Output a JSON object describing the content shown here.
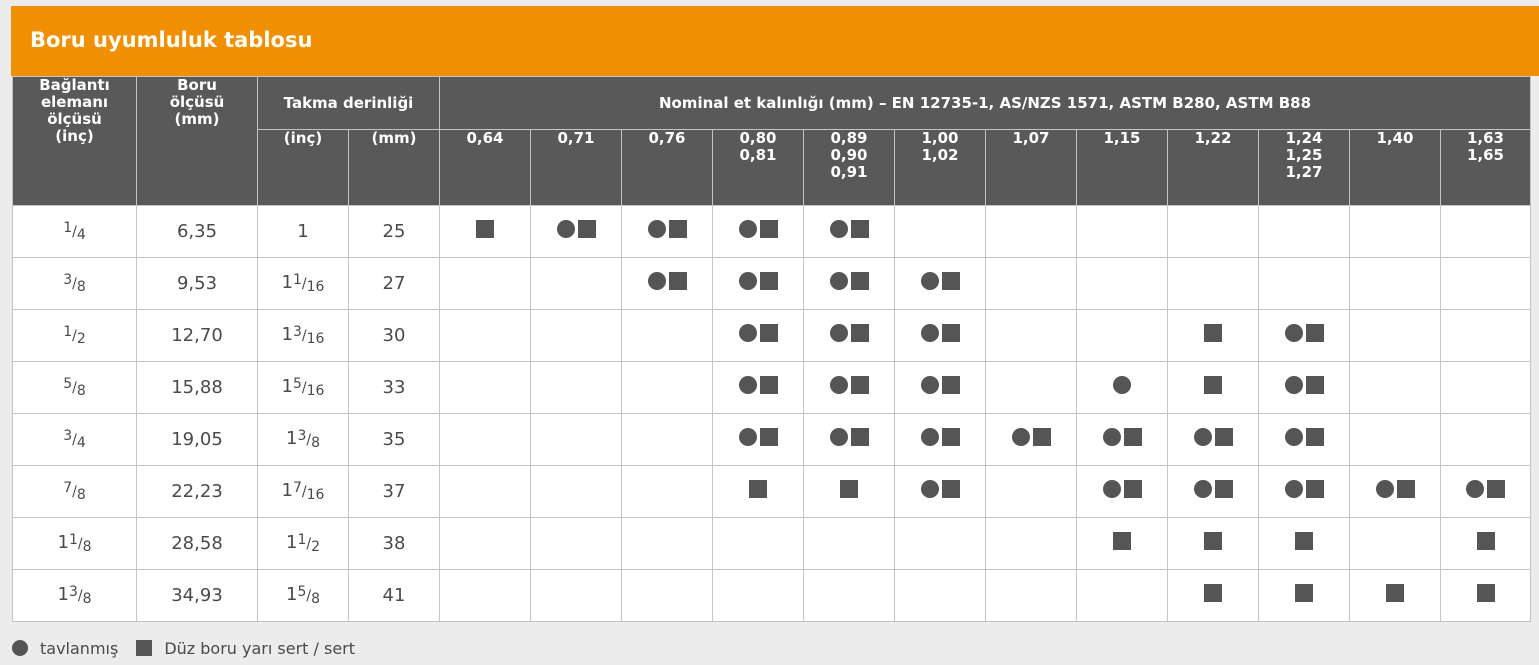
{
  "title": "Boru uyumluluk tablosu",
  "headers": {
    "connector": "Bağlantı elemanı ölçüsü (inç)",
    "pipe": "Boru ölçüsü (mm)",
    "depth": "Takma derinliği",
    "depth_inch": "(inç)",
    "depth_mm": "(mm)",
    "nominal": "Nominal et kalınlığı (mm) – EN 12735-1, AS/NZS 1571, ASTM B280, ASTM B88",
    "thicknesses": [
      "0,64",
      "0,71",
      "0,76",
      "0,80\n0,81",
      "0,89\n0,90\n0,91",
      "1,00\n1,02",
      "1,07",
      "1,15",
      "1,22",
      "1,24\n1,25\n1,27",
      "1,40",
      "1,63\n1,65"
    ]
  },
  "rows": [
    {
      "connector": "1/4",
      "pipe": "6,35",
      "depth_inch": "1",
      "depth_mm": "25",
      "cells": [
        "S",
        "CS",
        "CS",
        "CS",
        "CS",
        "",
        "",
        "",
        "",
        "",
        "",
        ""
      ]
    },
    {
      "connector": "3/8",
      "pipe": "9,53",
      "depth_inch": "1 1/16",
      "depth_mm": "27",
      "cells": [
        "",
        "",
        "CS",
        "CS",
        "CS",
        "CS",
        "",
        "",
        "",
        "",
        "",
        ""
      ]
    },
    {
      "connector": "1/2",
      "pipe": "12,70",
      "depth_inch": "1 3/16",
      "depth_mm": "30",
      "cells": [
        "",
        "",
        "",
        "CS",
        "CS",
        "CS",
        "",
        "",
        "S",
        "CS",
        "",
        ""
      ]
    },
    {
      "connector": "5/8",
      "pipe": "15,88",
      "depth_inch": "1 5/16",
      "depth_mm": "33",
      "cells": [
        "",
        "",
        "",
        "CS",
        "CS",
        "CS",
        "",
        "C",
        "S",
        "CS",
        "",
        ""
      ]
    },
    {
      "connector": "3/4",
      "pipe": "19,05",
      "depth_inch": "1 3/8",
      "depth_mm": "35",
      "cells": [
        "",
        "",
        "",
        "CS",
        "CS",
        "CS",
        "CS",
        "CS",
        "CS",
        "CS",
        "",
        ""
      ]
    },
    {
      "connector": "7/8",
      "pipe": "22,23",
      "depth_inch": "1 7/16",
      "depth_mm": "37",
      "cells": [
        "",
        "",
        "",
        "S",
        "S",
        "CS",
        "",
        "CS",
        "CS",
        "CS",
        "CS",
        "CS"
      ]
    },
    {
      "connector": "1 1/8",
      "pipe": "28,58",
      "depth_inch": "1 1/2",
      "depth_mm": "38",
      "cells": [
        "",
        "",
        "",
        "",
        "",
        "",
        "",
        "S",
        "S",
        "S",
        "",
        "S"
      ]
    },
    {
      "connector": "1 3/8",
      "pipe": "34,93",
      "depth_inch": "1 5/8",
      "depth_mm": "41",
      "cells": [
        "",
        "",
        "",
        "",
        "",
        "",
        "",
        "",
        "S",
        "S",
        "S",
        "S"
      ]
    }
  ],
  "legend": {
    "circle_label": "tavlanmış",
    "square_label": "Düz boru yarı sert / sert",
    "circle_icon": "filled-circle-icon",
    "square_icon": "filled-square-icon"
  },
  "colors": {
    "title_bg": "#f08f00",
    "header_bg": "#595959",
    "marker": "#555555"
  }
}
